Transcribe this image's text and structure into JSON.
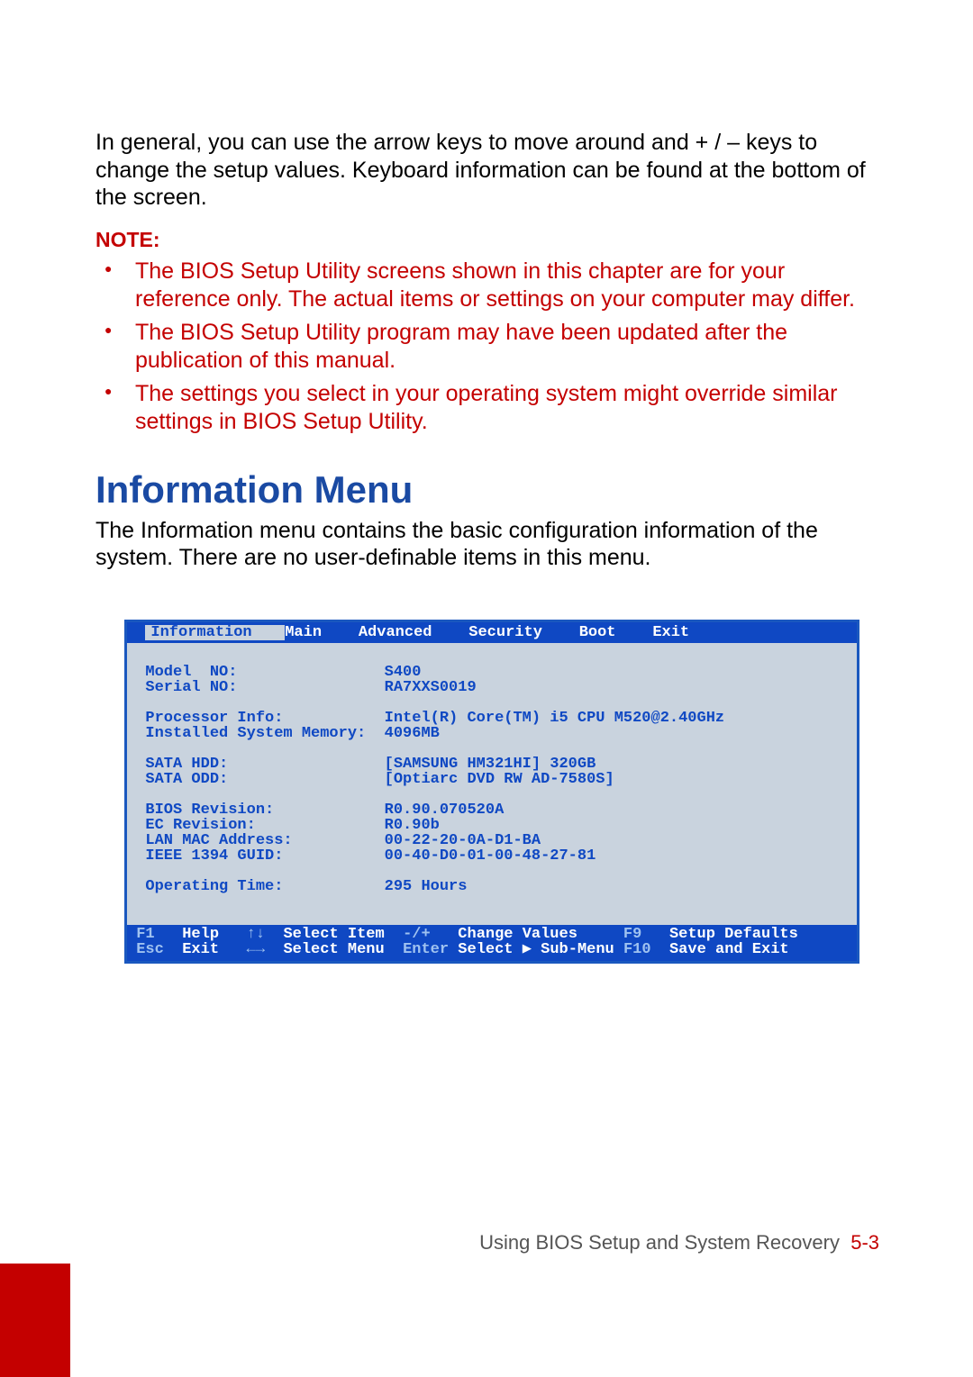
{
  "intro": "In general, you can use the arrow keys to move around and + / – keys to change the setup values. Keyboard information can be found at the bottom of the screen.",
  "note_label": "NOTE:",
  "notes": [
    "The BIOS Setup Utility screens shown in this chapter are for your reference only. The actual items or settings on your computer may differ.",
    "The BIOS Setup Utility program may have been updated after the publication of this manual.",
    "The settings you select in your operating system might override similar settings in BIOS Setup Utility."
  ],
  "section_heading": "Information Menu",
  "section_body": "The Information menu contains the basic configuration information of the system. There are no user-definable items in this menu.",
  "bios": {
    "tabs": [
      "Information",
      "Main",
      "Advanced",
      "Security",
      "Boot",
      "Exit"
    ],
    "selected_tab": 0,
    "fields": [
      {
        "label": "Model  NO:",
        "value": "S400"
      },
      {
        "label": "Serial NO:",
        "value": "RA7XXS0019"
      },
      {
        "label": "",
        "value": ""
      },
      {
        "label": "Processor Info:",
        "value": "Intel(R) Core(TM) i5 CPU M520@2.40GHz"
      },
      {
        "label": "Installed System Memory:",
        "value": "4096MB"
      },
      {
        "label": "",
        "value": ""
      },
      {
        "label": "SATA HDD:",
        "value": "[SAMSUNG HM321HI] 320GB"
      },
      {
        "label": "SATA ODD:",
        "value": "[Optiarc DVD RW AD-7580S]"
      },
      {
        "label": "",
        "value": ""
      },
      {
        "label": "BIOS Revision:",
        "value": "R0.90.070520A"
      },
      {
        "label": "EC Revision:",
        "value": "R0.90b"
      },
      {
        "label": "LAN MAC Address:",
        "value": "00-22-20-0A-D1-BA"
      },
      {
        "label": "IEEE 1394 GUID:",
        "value": "00-40-D0-01-00-48-27-81"
      },
      {
        "label": "",
        "value": ""
      },
      {
        "label": "Operating Time:",
        "value": "295 Hours"
      }
    ],
    "help": [
      {
        "key": "F1",
        "label": "Help"
      },
      {
        "key": "↑↓",
        "label": "Select Item"
      },
      {
        "key": "-/+",
        "label": "Change Values"
      },
      {
        "key": "F9",
        "label": "Setup Defaults"
      },
      {
        "key": "Esc",
        "label": "Exit"
      },
      {
        "key": "←→",
        "label": "Select Menu"
      },
      {
        "key": "Enter",
        "label": "Select ▶ Sub-Menu"
      },
      {
        "key": "F10",
        "label": "Save and Exit"
      }
    ]
  },
  "footer": {
    "title": "Using BIOS Setup and System Recovery",
    "page": "5-3"
  }
}
